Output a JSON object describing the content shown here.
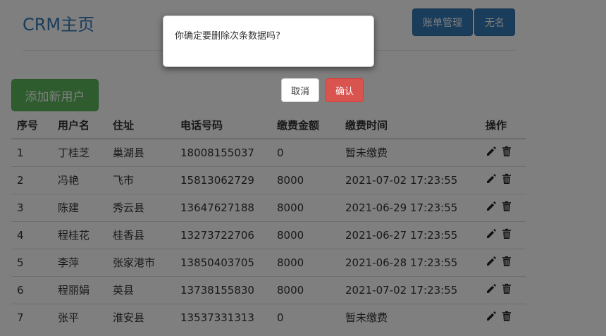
{
  "header": {
    "title": "CRM主页",
    "nav": {
      "bill_label": "账单管理",
      "name_label": "无名"
    }
  },
  "toolbar": {
    "add_user_label": "添加新用户"
  },
  "table": {
    "columns": [
      "序号",
      "用户名",
      "住址",
      "电话号码",
      "缴费金额",
      "缴费时间",
      "操作"
    ],
    "rows": [
      {
        "id": "1",
        "name": "丁桂芝",
        "address": "巢湖县",
        "phone": "18008155037",
        "amount": "0",
        "time": "暂未缴费"
      },
      {
        "id": "2",
        "name": "冯艳",
        "address": "飞市",
        "phone": "15813062729",
        "amount": "8000",
        "time": "2021-07-02 17:23:55"
      },
      {
        "id": "3",
        "name": "陈建",
        "address": "秀云县",
        "phone": "13647627188",
        "amount": "8000",
        "time": "2021-06-29 17:23:55"
      },
      {
        "id": "4",
        "name": "程桂花",
        "address": "桂香县",
        "phone": "13273722706",
        "amount": "8000",
        "time": "2021-06-27 17:23:55"
      },
      {
        "id": "5",
        "name": "李萍",
        "address": "张家港市",
        "phone": "13850403705",
        "amount": "8000",
        "time": "2021-06-28 17:23:55"
      },
      {
        "id": "6",
        "name": "程丽娟",
        "address": "英县",
        "phone": "13738155830",
        "amount": "8000",
        "time": "2021-07-02 17:23:55"
      },
      {
        "id": "7",
        "name": "张平",
        "address": "淮安县",
        "phone": "13537331313",
        "amount": "0",
        "time": "暂未缴费"
      }
    ],
    "actions": [
      "edit-icon",
      "trash-icon"
    ]
  },
  "dialog": {
    "message": "你确定要删除次条数据吗?",
    "cancel_label": "取消",
    "confirm_label": "确认"
  },
  "colors": {
    "primary": "#337ab7",
    "success": "#5cb85c",
    "danger": "#d9534f",
    "overlay": "rgba(0,0,0,0.5)"
  }
}
